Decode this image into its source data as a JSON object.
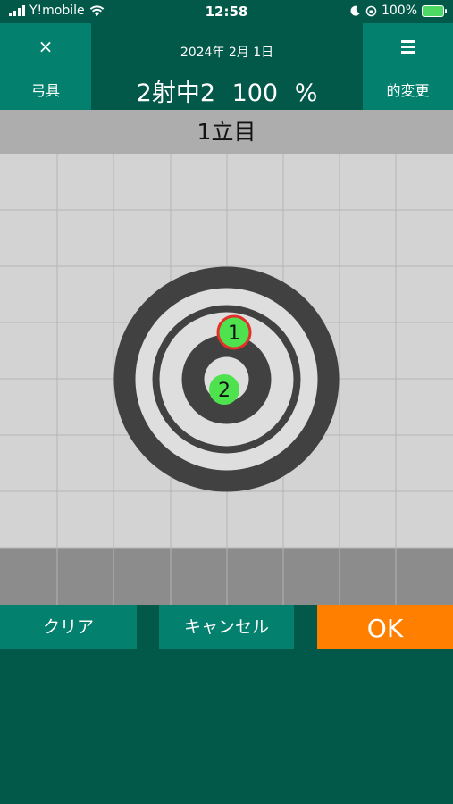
{
  "status_bar": {
    "carrier": "Y!mobile",
    "time": "12:58",
    "battery": "100%",
    "icons": [
      "signal-icon",
      "wifi-icon",
      "moon-icon",
      "orientation-lock-icon",
      "battery-charging-icon"
    ]
  },
  "header": {
    "left_glyph": "×",
    "left_label": "弓具",
    "date": "2024年 2月 1日",
    "score": "2射中2 100 %",
    "right_label": "的変更",
    "right_icon": "menu-icon"
  },
  "round_label": "1立目",
  "target": {
    "shots": [
      {
        "label": "1",
        "highlighted": true
      },
      {
        "label": "2",
        "highlighted": false
      }
    ],
    "colors": {
      "ring_dark": "#414141",
      "ring_light": "#dedede",
      "grid_bg": "#d3d3d3",
      "lower_band": "#8c8c8c",
      "shot_fill": "#4fe24f",
      "shot_highlight": "#e4302a"
    }
  },
  "buttons": {
    "clear": "クリア",
    "cancel": "キャンセル",
    "ok": "OK"
  },
  "colors": {
    "background": "#02594a",
    "accent": "#04806e",
    "ok": "#ff7f00",
    "banner": "#adadad"
  }
}
